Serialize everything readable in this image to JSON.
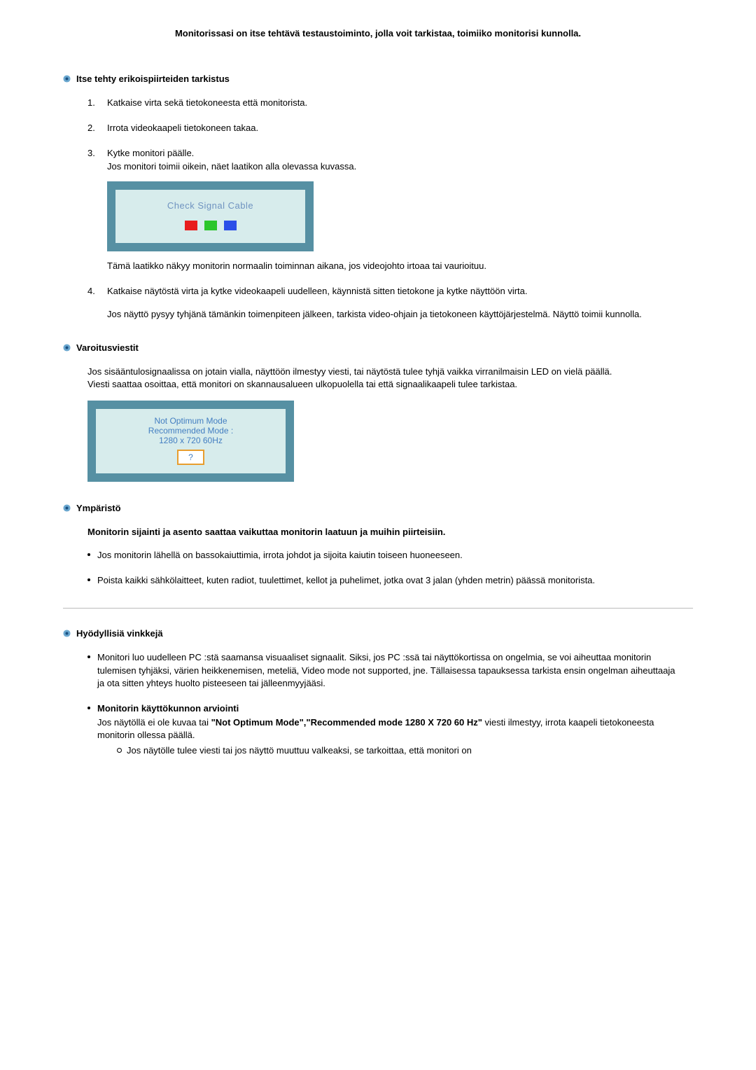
{
  "intro": "Monitorissasi on itse tehtävä testaustoiminto, jolla voit tarkistaa, toimiiko monitorisi kunnolla.",
  "section1": {
    "title": "Itse tehty erikoispiirteiden tarkistus",
    "step1": "Katkaise virta sekä tietokoneesta että monitorista.",
    "step2": "Irrota videokaapeli tietokoneen takaa.",
    "step3a": "Kytke monitori päälle.",
    "step3b": "Jos monitori toimii oikein, näet laatikon alla olevassa kuvassa.",
    "diagramText": "Check Signal Cable",
    "step3c": "Tämä laatikko näkyy monitorin normaalin toiminnan aikana, jos videojohto irtoaa tai vaurioituu.",
    "step4a": "Katkaise näytöstä virta ja kytke videokaapeli uudelleen, käynnistä sitten tietokone ja kytke näyttöön virta.",
    "step4b": "Jos näyttö pysyy tyhjänä tämänkin toimenpiteen jälkeen, tarkista video-ohjain ja tietokoneen käyttöjärjestelmä. Näyttö toimii kunnolla."
  },
  "section2": {
    "title": "Varoitusviestit",
    "para": "Jos sisääntulosignaalissa on jotain vialla, näyttöön ilmestyy viesti, tai näytöstä tulee tyhjä vaikka virranilmaisin LED on vielä päällä.",
    "para2": "Viesti saattaa osoittaa, että monitori on skannausalueen ulkopuolella tai että signaalikaapeli tulee tarkistaa.",
    "optLine1": "Not Optimum Mode",
    "optLine2": "Recommended Mode :",
    "optLine3": "1280 x 720   60Hz",
    "optQ": "?"
  },
  "section3": {
    "title": "Ympäristö",
    "heading": "Monitorin sijainti ja asento saattaa vaikuttaa monitorin laatuun ja muihin piirteisiin.",
    "bullet1": "Jos monitorin lähellä on bassokaiuttimia, irrota johdot ja sijoita kaiutin toiseen huoneeseen.",
    "bullet2": "Poista kaikki sähkölaitteet, kuten radiot, tuulettimet, kellot ja puhelimet, jotka ovat 3 jalan (yhden metrin) päässä monitorista."
  },
  "section4": {
    "title": "Hyödyllisiä vinkkejä",
    "bullet1": "Monitori luo uudelleen PC :stä saamansa visuaaliset signaalit. Siksi, jos PC :ssä tai näyttökortissa on ongelmia, se voi aiheuttaa monitorin tulemisen tyhjäksi, värien heikkenemisen, meteliä, Video mode not supported, jne. Tällaisessa tapauksessa tarkista ensin ongelman aiheuttaaja ja ota sitten yhteys huolto pisteeseen tai jälleenmyyjääsi.",
    "bullet2Title": "Monitorin käyttökunnon arviointi",
    "bullet2a": "Jos näytöllä ei ole kuvaa tai ",
    "bullet2Bold": "\"Not Optimum Mode\",\"Recommended mode 1280 X 720 60 Hz\"",
    "bullet2b": " viesti ilmestyy, irrota kaapeli tietokoneesta monitorin ollessa päällä.",
    "sub1": "Jos näytölle tulee viesti tai jos näyttö muuttuu valkeaksi, se tarkoittaa, että monitori on"
  }
}
